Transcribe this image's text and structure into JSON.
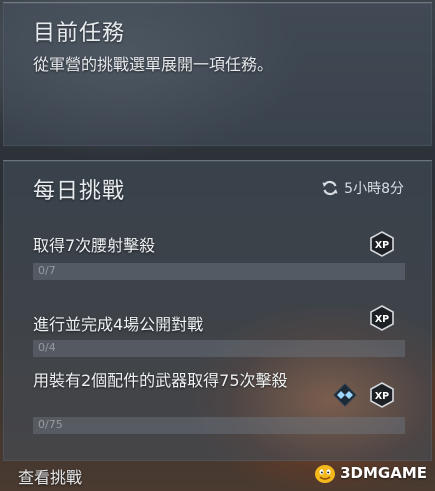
{
  "current_mission": {
    "title": "目前任務",
    "description": "從軍營的挑戰選單展開一項任務。"
  },
  "daily_challenges": {
    "title": "每日挑戰",
    "timer_icon": "refresh-icon",
    "timer": "5小時8分",
    "items": [
      {
        "name": "取得7次腰射擊殺",
        "progress_label": "0/7",
        "progress": 0,
        "rewards": [
          "xp-icon"
        ]
      },
      {
        "name": "進行並完成4場公開對戰",
        "progress_label": "0/4",
        "progress": 0,
        "rewards": [
          "xp-icon"
        ]
      },
      {
        "name": "用裝有2個配件的武器取得75次擊殺",
        "progress_label": "0/75",
        "progress": 0,
        "rewards": [
          "diamond-icon",
          "xp-icon"
        ]
      }
    ]
  },
  "footer": {
    "view_challenges": "查看挑戰"
  },
  "watermark": {
    "text": "3DMGAME"
  },
  "colors": {
    "accent_text": "#e8ecef",
    "bar_bg": "#6e7882",
    "gem": "#8fd0ff"
  }
}
